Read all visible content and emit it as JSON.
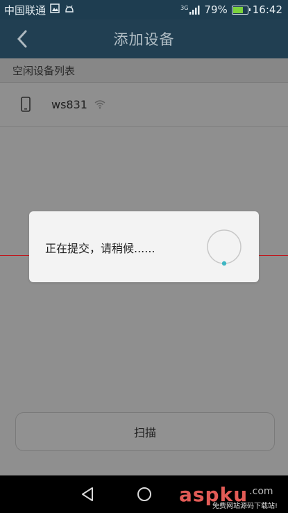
{
  "status_bar": {
    "carrier": "中国联通",
    "network": "3G",
    "battery": "79%",
    "battery_level": 0.79,
    "time": "16:42",
    "accent": "#7bd23d"
  },
  "header": {
    "title": "添加设备",
    "back_icon": "chevron-left-icon"
  },
  "list": {
    "section_title": "空闲设备列表",
    "devices": [
      {
        "name": "ws831",
        "icon": "phone-icon",
        "signal_icon": "wifi-icon"
      }
    ]
  },
  "dialog": {
    "message": "正在提交，请稍候......"
  },
  "scan_button": {
    "label": "扫描"
  },
  "nav_bar": {
    "back_icon": "back-triangle-icon",
    "home_icon": "home-circle-icon"
  },
  "watermark": {
    "brand": "aspku",
    "tld": ".com",
    "slogan": "免费网站源码下载站!"
  }
}
